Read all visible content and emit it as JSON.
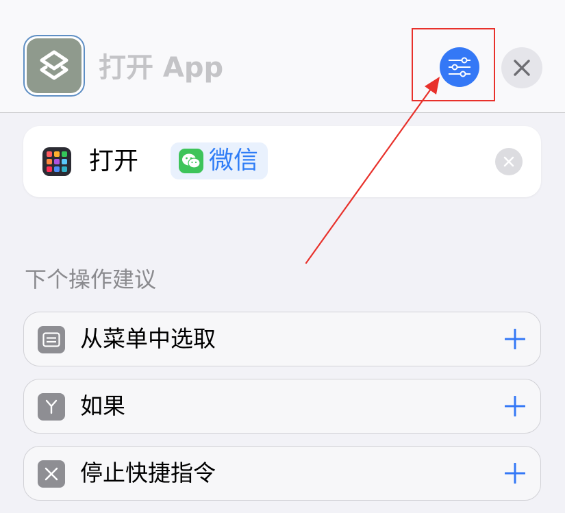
{
  "header": {
    "title": "打开 App",
    "app_icon": "shortcuts-icon",
    "filter_icon": "sliders-icon",
    "close_icon": "close-icon"
  },
  "action": {
    "verb": "打开",
    "app_label": "微信",
    "app_icon": "wechat-icon",
    "leading_icon": "app-grid-icon",
    "clear_icon": "clear-circle-icon"
  },
  "suggestions": {
    "header": "下个操作建议",
    "items": [
      {
        "label": "从菜单中选取",
        "icon": "menu-icon"
      },
      {
        "label": "如果",
        "icon": "branch-icon"
      },
      {
        "label": "停止快捷指令",
        "icon": "stop-icon"
      }
    ]
  },
  "colors": {
    "accent": "#3478f6",
    "annotation": "#e8312b",
    "wechat": "#3ec45a",
    "header_icon_bg": "#8f9a8d"
  }
}
